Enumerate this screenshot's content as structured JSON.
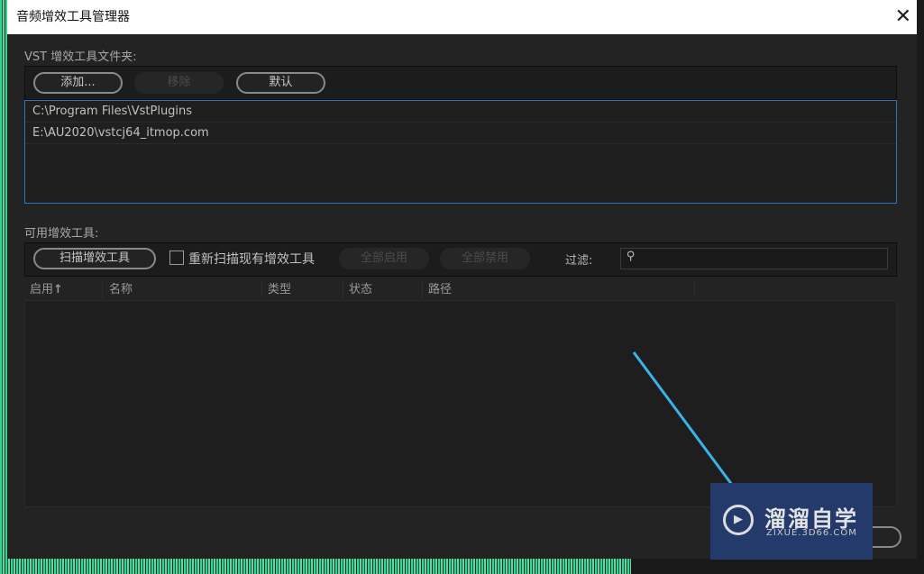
{
  "window": {
    "title": "音频增效工具管理器",
    "close_icon": "close-icon"
  },
  "folders": {
    "label": "VST 增效工具文件夹:",
    "add": "添加...",
    "remove": "移除",
    "default": "默认",
    "paths": [
      "C:\\Program Files\\VstPlugins",
      "E:\\AU2020\\vstcj64_itmop.com"
    ]
  },
  "plugins": {
    "label": "可用增效工具:",
    "scan": "扫描增效工具",
    "rescan": "重新扫描现有增效工具",
    "rescan_checked": false,
    "enable_all": "全部启用",
    "disable_all": "全部禁用",
    "filter_label": "过滤:",
    "filter_value": "",
    "columns": [
      "启用",
      "名称",
      "类型",
      "状态",
      "路径"
    ],
    "sort_icon": "↑"
  },
  "watermark": {
    "name": "溜溜自学",
    "url": "ZIXUE.3D66.COM",
    "color": "#233a6b"
  },
  "colors": {
    "accent": "#2f74c0",
    "annotation": "#3ab4e6"
  }
}
